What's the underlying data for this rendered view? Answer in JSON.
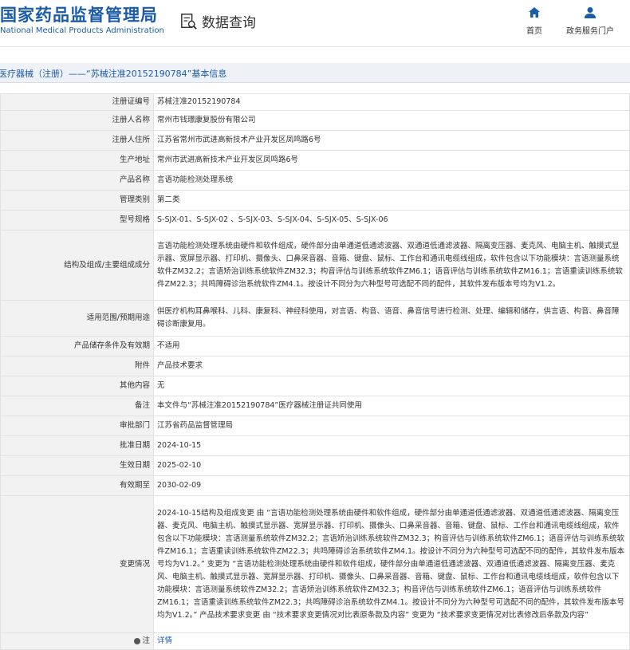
{
  "header": {
    "logo_cn": "国家药品监督管理局",
    "logo_en": "National Medical Products Administration",
    "data_query": "数据查询",
    "nav": [
      {
        "label": "首页",
        "icon": "home-icon"
      },
      {
        "label": "政务服务门户",
        "icon": "user-icon"
      }
    ]
  },
  "page_title": "境内医疗器械（注册）——“苏械注准20152190784”基本信息",
  "rows": [
    {
      "label": "注册证编号",
      "value": "苏械注准20152190784"
    },
    {
      "label": "注册人名称",
      "value": "常州市钱璟康复股份有限公司"
    },
    {
      "label": "注册人住所",
      "value": "江苏省常州市武进高新技术产业开发区凤鸣路6号"
    },
    {
      "label": "生产地址",
      "value": "常州市武进高新技术产业开发区凤鸣路6号"
    },
    {
      "label": "产品名称",
      "value": "言语功能检测处理系统"
    },
    {
      "label": "管理类别",
      "value": "第二类"
    },
    {
      "label": "型号规格",
      "value": "S-SJX-01、S-SJX-02 、S-SJX-03、S-SJX-04、S-SJX-05、S-SJX-06"
    },
    {
      "label": "结构及组成/主要组成成分",
      "value": "言语功能检测处理系统由硬件和软件组成，硬件部分由单通道低通滤波器、双通道低通滤波器、隔离变压器、麦克风、电脑主机、触摸式显示器、宽屏显示器、打印机、摄像头、口鼻采音器、音箱、键盘、鼠标、工作台和通讯电缆线组成，软件包含以下功能模块：言语测量系统软件ZM32.2；言语矫治训练系统软件ZM32.3；构音评估与训练系统软件ZM6.1；语音评估与训练系统软件ZM16.1；言语重读训练系统软件ZM22.3；共鸣障碍诊治系统软件ZM4.1。按设计不同分为六种型号可选配不同的配件，其软件发布版本号均为V1.2。"
    },
    {
      "label": "适用范围/预期用途",
      "value": "供医疗机构耳鼻喉科、儿科、康复科、神经科使用，对言语、构音、语音、鼻音信号进行检测、处理、编辑和储存，供言语、构音、鼻音障碍诊断康复用。"
    },
    {
      "label": "产品储存条件及有效期",
      "value": "不适用"
    },
    {
      "label": "附件",
      "value": "产品技术要求"
    },
    {
      "label": "其他内容",
      "value": "无"
    },
    {
      "label": "备注",
      "value": "本文件与“苏械注准20152190784”医疗器械注册证共同使用"
    },
    {
      "label": "审批部门",
      "value": "江苏省药品监督管理局"
    },
    {
      "label": "批准日期",
      "value": "2024-10-15"
    },
    {
      "label": "生效日期",
      "value": "2025-02-10"
    },
    {
      "label": "有效期至",
      "value": "2030-02-09"
    },
    {
      "label": "变更情况",
      "value": "2024-10-15结构及组成变更 由 “言语功能检测处理系统由硬件和软件组成，硬件部分由单通道低通滤波器、双通道低通滤波器、隔离变压器、麦克风、电脑主机、触摸式显示器、宽屏显示器、打印机、摄像头、口鼻采音器、音箱、键盘、鼠标、工作台和通讯电缆线组成，软件包含以下功能模块：言语测量系统软件ZM32.2；言语矫治训练系统软件ZM32.3；构音评估与训练系统软件ZM6.1；语音评估与训练系统软件ZM16.1；言语重读训练系统软件ZM22.3；共鸣障碍诊治系统软件ZM4.1。按设计不同分为六种型号可选配不同的配件，其软件发布版本号均为V1.2。” 变更为 “言语功能检测处理系统由硬件和软件组成，硬件部分由单通道低通滤波器、双通道低通滤波器、隔离变压器、麦克风、电脑主机、触摸式显示器、宽屏显示器、打印机、摄像头、口鼻采音器、音箱、键盘、鼠标、工作台和通讯电缆线组成，软件包含以下功能模块：言语测量系统软件ZM32.2；言语矫治训练系统软件ZM32.3；构音评估与训练系统软件ZM6.1；语音评估与训练系统软件ZM16.1；言语重读训练系统软件ZM22.3；共鸣障碍诊治系统软件ZM4.1。按设计不同分为六种型号可选配不同的配件，其软件发布版本号均为V1.2。” 产品技术要求变更 由 “技术要求变更情况对比表原条款及内容” 变更为 “技术要求变更情况对比表修改后条款及内容”"
    }
  ],
  "note": {
    "label": "注",
    "link": "详情"
  }
}
